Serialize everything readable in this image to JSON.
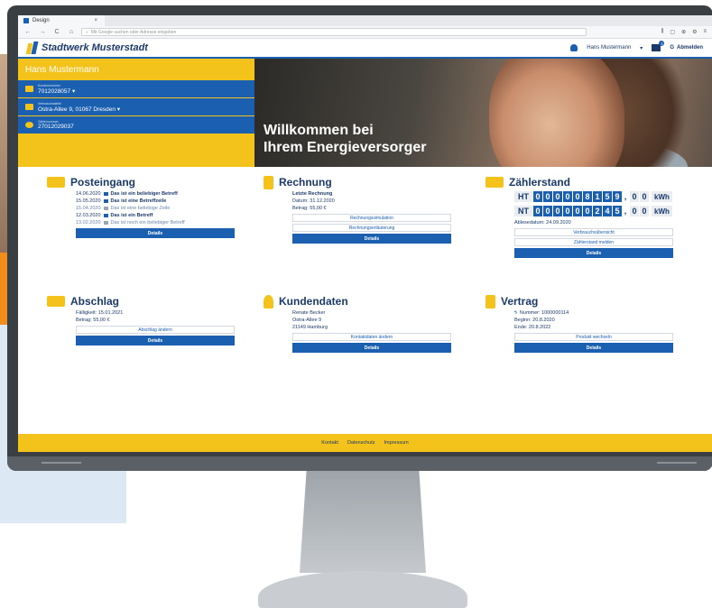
{
  "browser": {
    "tab_title": "Design",
    "tab_close": "×",
    "url_placeholder": "Mit Google suchen oder Adresse eingeben",
    "back": "←",
    "forward": "→",
    "reload": "C",
    "home": "⌂",
    "search_glyph": "⌕",
    "tool_1": "⫼",
    "tool_2": "▢",
    "tool_3": "⊕",
    "tool_4": "⚙",
    "tool_5": "≡"
  },
  "header": {
    "logo_text": "Stadtwerk Musterstadt",
    "user_name": "Hans Mustermann",
    "user_caret": "▾",
    "mail_count": "3",
    "logout_glyph": "G",
    "logout_label": "Abmelden"
  },
  "hero": {
    "customer_name": "Hans Mustermann",
    "customer_number_label": "Kundennummer",
    "customer_number": "7012028057 ▾",
    "address_label": "Verbrauchsstelle",
    "address": "Ostra-Allee 9, 01067 Dresden ▾",
    "meter_label": "Zählernummer",
    "meter_number": "27012029037",
    "title_line1": "Willkommen bei",
    "title_line2": "Ihrem Energieversorger"
  },
  "posteingang": {
    "title": "Posteingang",
    "items": [
      {
        "date": "14.06.2020",
        "text": "Das ist ein beliebiger Betreff"
      },
      {
        "date": "15.05.2020",
        "text": "Das ist eine Betreffzeile"
      },
      {
        "date": "15.04.2020",
        "text": "Das ist eine beliebige Zeile"
      },
      {
        "date": "12.03.2020",
        "text": "Das ist ein Betreff"
      },
      {
        "date": "13.02.2020",
        "text": "Das ist noch ein beliebiger Betreff"
      }
    ],
    "details": "Details"
  },
  "rechnung": {
    "title": "Rechnung",
    "heading": "Letzte Rechnung",
    "date": "Datum: 31.12.2020",
    "amount": "Betrag: 55,00 €",
    "btn_simulation": "Rechnungssimulation",
    "btn_explain": "Rechnungserläuterung",
    "details": "Details"
  },
  "zaehlerstand": {
    "title": "Zählerstand",
    "ht_label": "HT",
    "ht_digits": [
      "0",
      "0",
      "0",
      "0",
      "0",
      "8",
      "1",
      "5",
      "9"
    ],
    "ht_decimals": [
      "0",
      "0"
    ],
    "nt_label": "NT",
    "nt_digits": [
      "0",
      "0",
      "0",
      "0",
      "0",
      "0",
      "2",
      "4",
      "5"
    ],
    "nt_decimals": [
      "0",
      "0"
    ],
    "sep": ",",
    "unit": "kWh",
    "read_date": "Ablesedatum: 24.09.2020",
    "btn_overview": "Verbrauchsübersicht",
    "btn_report": "Zählerstand melden",
    "details": "Details"
  },
  "abschlag": {
    "title": "Abschlag",
    "due": "Fälligkeit: 15.01.2021",
    "amount": "Betrag: 55,00 €",
    "btn_change": "Abschlag ändern",
    "details": "Details"
  },
  "kundendaten": {
    "title": "Kundendaten",
    "name": "Renate Becker",
    "street": "Ostra-Allee 9",
    "city": "21149 Hamburg",
    "btn_change": "Kontaktdaten ändern",
    "details": "Details"
  },
  "vertrag": {
    "title": "Vertrag",
    "number": "Nummer: 1000000114",
    "start": "Beginn: 20.8.2020",
    "end": "Ende: 20.8.2022",
    "btn_switch": "Produkt wechseln",
    "details": "Details"
  },
  "footer": {
    "contact": "Kontakt",
    "privacy": "Datenschutz",
    "imprint": "Impressum"
  },
  "colors": {
    "brand_blue": "#1b5fb0",
    "brand_yellow": "#f3c21b",
    "navy": "#1b3a6b"
  }
}
